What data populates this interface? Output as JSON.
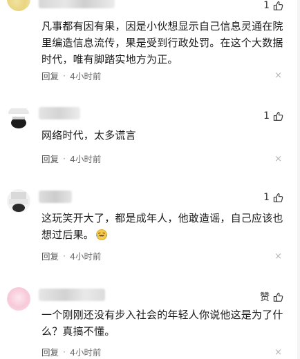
{
  "comments": [
    {
      "likes": "1",
      "text": "凡事都有因有果，因是小伙想显示自己信息灵通在院里编造信息流传，果是受到行政处罚。在这个大数据时代，唯有脚踏实地方为正。",
      "reply_label": "回复",
      "time": "4小时前",
      "close": "×"
    },
    {
      "likes": "1",
      "text": "网络时代，太多谎言",
      "reply_label": "回复",
      "time": "4小时前",
      "close": "×"
    },
    {
      "likes": "1",
      "text": "这玩笑开大了，都是成年人，他敢造谣，自己应该也想过后果。",
      "reply_label": "回复",
      "time": "4小时前",
      "close": "×"
    },
    {
      "likes": "赞",
      "text": "一个刚刚还没有步入社会的年轻人你说他这是为了什么？真搞不懂。",
      "reply_label": "回复",
      "time": "4小时前",
      "close": "×"
    }
  ],
  "separator": "·",
  "icons": {
    "like": "thumbs-up-icon",
    "emoji": "laughing-tears-emoji-icon",
    "close": "close-icon"
  },
  "colors": {
    "meta_text": "#6b6b6b",
    "close": "#b5b5b5"
  }
}
